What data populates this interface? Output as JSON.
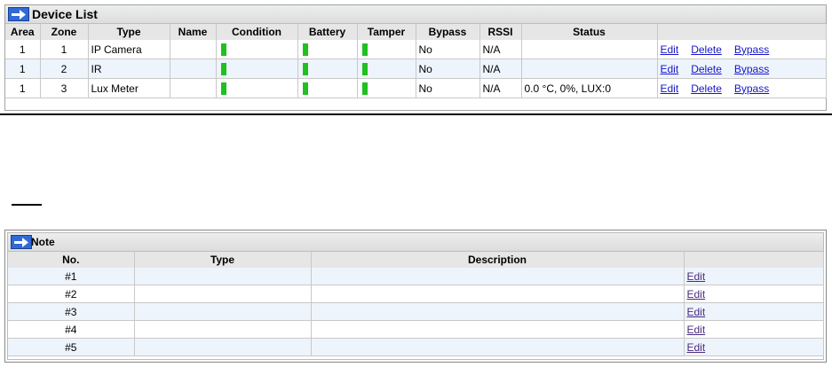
{
  "device_list": {
    "title": "Device List",
    "columns": [
      "Area",
      "Zone",
      "Type",
      "Name",
      "Condition",
      "Battery",
      "Tamper",
      "Bypass",
      "RSSI",
      "Status",
      ""
    ],
    "rows": [
      {
        "area": "1",
        "zone": "1",
        "type": "IP Camera",
        "name": "",
        "condition": "ok",
        "battery": "ok",
        "tamper": "ok",
        "bypass": "No",
        "rssi": "N/A",
        "status": "",
        "actions": [
          "Edit",
          "Delete",
          "Bypass"
        ]
      },
      {
        "area": "1",
        "zone": "2",
        "type": "IR",
        "name": "",
        "condition": "ok",
        "battery": "ok",
        "tamper": "ok",
        "bypass": "No",
        "rssi": "N/A",
        "status": "",
        "actions": [
          "Edit",
          "Delete",
          "Bypass"
        ]
      },
      {
        "area": "1",
        "zone": "3",
        "type": "Lux Meter",
        "name": "",
        "condition": "ok",
        "battery": "ok",
        "tamper": "ok",
        "bypass": "No",
        "rssi": "N/A",
        "status": "0.0 °C, 0%, LUX:0",
        "actions": [
          "Edit",
          "Delete",
          "Bypass"
        ]
      }
    ]
  },
  "note": {
    "title": "Note",
    "columns": [
      "No.",
      "Type",
      "Description",
      ""
    ],
    "rows": [
      {
        "no": "#1",
        "type": "",
        "description": "",
        "action": "Edit"
      },
      {
        "no": "#2",
        "type": "",
        "description": "",
        "action": "Edit"
      },
      {
        "no": "#3",
        "type": "",
        "description": "",
        "action": "Edit"
      },
      {
        "no": "#4",
        "type": "",
        "description": "",
        "action": "Edit"
      },
      {
        "no": "#5",
        "type": "",
        "description": "",
        "action": "Edit"
      }
    ]
  },
  "colors": {
    "indicator_ok": "#1fc01f",
    "link": "#1515c8",
    "row_alt": "#eef4fb",
    "header_bg": "#e5e6e5"
  },
  "icons": {
    "panel_icon": "arrow-right-icon"
  }
}
